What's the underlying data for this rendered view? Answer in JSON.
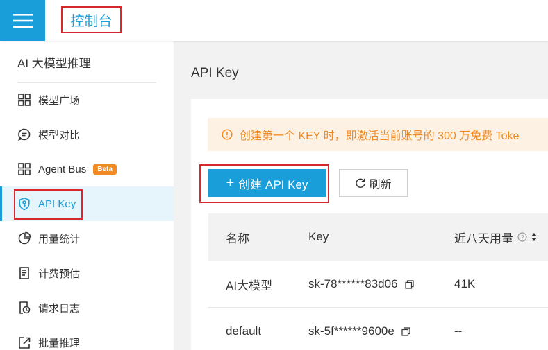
{
  "header": {
    "menu_icon": "hamburger-menu-icon",
    "console_title": "控制台"
  },
  "sidebar": {
    "heading": "AI 大模型推理",
    "items": [
      {
        "label": "模型广场",
        "icon": "grid-icon"
      },
      {
        "label": "模型对比",
        "icon": "chat-compare-icon"
      },
      {
        "label": "Agent Bus",
        "icon": "grid-icon",
        "badge": "Beta"
      },
      {
        "label": "API Key",
        "icon": "shield-key-icon",
        "active": true
      },
      {
        "label": "用量统计",
        "icon": "pie-chart-icon"
      },
      {
        "label": "计费预估",
        "icon": "receipt-icon"
      },
      {
        "label": "请求日志",
        "icon": "clock-file-icon"
      },
      {
        "label": "批量推理",
        "icon": "export-icon"
      }
    ]
  },
  "main": {
    "page_title": "API Key",
    "alert_text": "创建第一个 KEY 时，即激活当前账号的 300 万免费 Toke",
    "create_button": "创建 API Key",
    "refresh_button": "刷新",
    "table": {
      "columns": [
        "名称",
        "Key",
        "近八天用量"
      ],
      "rows": [
        {
          "name": "AI大模型",
          "key": "sk-78******83d06",
          "usage": "41K"
        },
        {
          "name": "default",
          "key": "sk-5f******9600e",
          "usage": "--"
        }
      ]
    }
  },
  "colors": {
    "accent": "#1a9ed9",
    "warning": "#f08a24",
    "highlight_outline": "#d9272e"
  }
}
